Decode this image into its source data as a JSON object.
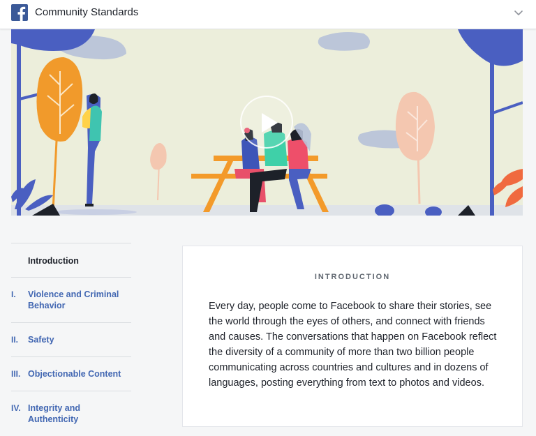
{
  "header": {
    "title": "Community Standards",
    "logo_icon": "facebook-f-logo",
    "menu_icon": "chevron-down-icon"
  },
  "hero": {
    "play_icon": "play-icon"
  },
  "sidebar": {
    "items": [
      {
        "number": "",
        "label": "Introduction",
        "active": true
      },
      {
        "number": "I.",
        "label": "Violence and Criminal Behavior",
        "active": false
      },
      {
        "number": "II.",
        "label": "Safety",
        "active": false
      },
      {
        "number": "III.",
        "label": "Objectionable Content",
        "active": false
      },
      {
        "number": "IV.",
        "label": "Integrity and Authenticity",
        "active": false
      }
    ]
  },
  "main": {
    "heading": "INTRODUCTION",
    "body": "Every day, people come to Facebook to share their stories, see the world through the eyes of others, and connect with friends and causes. The conversations that happen on Facebook reflect the diversity of a community of more than two billion people communicating across countries and cultures and in dozens of languages, posting everything from text to photos and videos."
  },
  "colors": {
    "brand_blue": "#3b5998",
    "link_blue": "#4267b2",
    "hero_bg": "#eceedb",
    "page_bg": "#f5f6f7"
  }
}
